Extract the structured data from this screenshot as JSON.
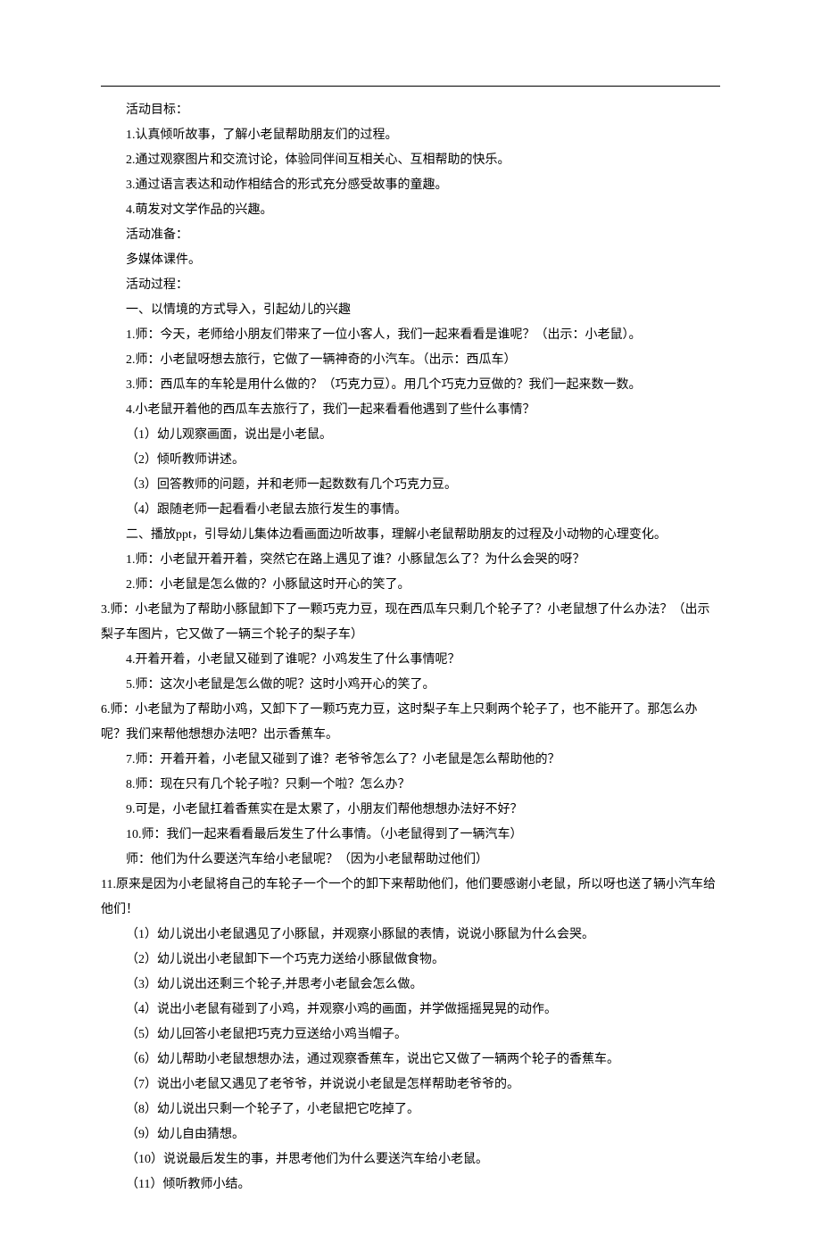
{
  "lines": [
    "活动目标：",
    "1.认真倾听故事，了解小老鼠帮助朋友们的过程。",
    "2.通过观察图片和交流讨论，体验同伴间互相关心、互相帮助的快乐。",
    "3.通过语言表达和动作相结合的形式充分感受故事的童趣。",
    "4.萌发对文学作品的兴趣。",
    "活动准备：",
    "多媒体课件。",
    "活动过程：",
    "一、以情境的方式导入，引起幼儿的兴趣",
    "1.师：今天，老师给小朋友们带来了一位小客人，我们一起来看看是谁呢？（出示：小老鼠）。",
    "2.师：小老鼠呀想去旅行，它做了一辆神奇的小汽车。（出示：西瓜车）",
    "3.师：西瓜车的车轮是用什么做的？（巧克力豆）。用几个巧克力豆做的？我们一起来数一数。",
    "4.小老鼠开着他的西瓜车去旅行了，我们一起来看看他遇到了些什么事情？",
    "（1）幼儿观察画面，说出是小老鼠。",
    "（2）倾听教师讲述。",
    "（3）回答教师的问题，并和老师一起数数有几个巧克力豆。",
    "（4）跟随老师一起看看小老鼠去旅行发生的事情。",
    "二、播放ppt，引导幼儿集体边看画面边听故事，理解小老鼠帮助朋友的过程及小动物的心理变化。",
    "1.师：小老鼠开着开着，突然它在路上遇见了谁？小豚鼠怎么了？为什么会哭的呀？",
    "2.师：小老鼠是怎么做的？小豚鼠这时开心的笑了。",
    "3.师：小老鼠为了帮助小豚鼠卸下了一颗巧克力豆，现在西瓜车只剩几个轮子了？小老鼠想了什么办法？（出示梨子车图片，它又做了一辆三个轮子的梨子车）",
    "4.开着开着，小老鼠又碰到了谁呢？小鸡发生了什么事情呢？",
    "5.师：这次小老鼠是怎么做的呢？这时小鸡开心的笑了。",
    "6.师：小老鼠为了帮助小鸡，又卸下了一颗巧克力豆，这时梨子车上只剩两个轮子了，也不能开了。那怎么办呢？我们来帮他想想办法吧？出示香蕉车。",
    "7.师：开着开着，小老鼠又碰到了谁？老爷爷怎么了？小老鼠是怎么帮助他的？",
    "8.师：现在只有几个轮子啦？只剩一个啦？怎么办？",
    "9.可是，小老鼠扛着香蕉实在是太累了，小朋友们帮他想想办法好不好？",
    "10.师：我们一起来看看最后发生了什么事情。（小老鼠得到了一辆汽车）",
    "师：他们为什么要送汽车给小老鼠呢？（因为小老鼠帮助过他们）",
    "11.原来是因为小老鼠将自己的车轮子一个一个的卸下来帮助他们，他们要感谢小老鼠，所以呀也送了辆小汽车给他们！",
    "（1）幼儿说出小老鼠遇见了小豚鼠，并观察小豚鼠的表情，说说小豚鼠为什么会哭。",
    "（2）幼儿说出小老鼠卸下一个巧克力送给小豚鼠做食物。",
    "（3）幼儿说出还剩三个轮子,并思考小老鼠会怎么做。",
    "（4）说出小老鼠有碰到了小鸡，并观察小鸡的画面，并学做摇摇晃晃的动作。",
    "（5）幼儿回答小老鼠把巧克力豆送给小鸡当帽子。",
    "（6）幼儿帮助小老鼠想想办法，通过观察香蕉车，说出它又做了一辆两个轮子的香蕉车。",
    "（7）说出小老鼠又遇见了老爷爷，并说说小老鼠是怎样帮助老爷爷的。",
    "（8）幼儿说出只剩一个轮子了，小老鼠把它吃掉了。",
    "（9）幼儿自由猜想。",
    "（10）说说最后发生的事，并思考他们为什么要送汽车给小老鼠。",
    "（11）倾听教师小结。"
  ],
  "wrap_indices": [
    20,
    23,
    29
  ]
}
